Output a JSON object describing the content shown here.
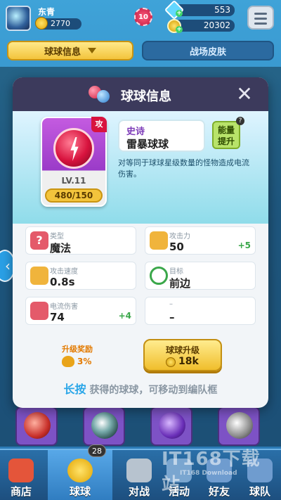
{
  "player": {
    "name": "东青",
    "trophies": "2770",
    "level": "10"
  },
  "currency": {
    "gems": "553",
    "coins": "20302"
  },
  "tabs": [
    {
      "label": "球球信息"
    },
    {
      "label": "战场皮肤"
    }
  ],
  "modal": {
    "title": "球球信息",
    "ball": {
      "type_tag": "攻",
      "level": "LV.11",
      "xp": "480/150",
      "rarity": "史诗",
      "name": "雷暴球球",
      "description": "对等同于球球星级数量的怪物造成电流伤害。"
    },
    "upgrade_chip": "能量\n提升",
    "help_mark": "?",
    "stats": [
      {
        "label": "类型",
        "value": "魔法",
        "plus": "",
        "icon": "question-icon",
        "icon_color": "#e45a6a"
      },
      {
        "label": "攻击力",
        "value": "50",
        "plus": "+5",
        "icon": "sword-icon",
        "icon_color": "#f0b43c"
      },
      {
        "label": "攻击速度",
        "value": "0.8s",
        "plus": "",
        "icon": "crossed-swords-icon",
        "icon_color": "#f0b43c"
      },
      {
        "label": "目标",
        "value": "前边",
        "plus": "",
        "icon": "target-icon",
        "icon_color": "#3aa74a"
      },
      {
        "label": "电流伤害",
        "value": "74",
        "plus": "+4",
        "icon": "lightning-icon",
        "icon_color": "#e45a6a"
      },
      {
        "label": "–",
        "value": "–",
        "plus": "",
        "icon": "",
        "icon_color": "#ffffff"
      }
    ],
    "reward": {
      "label": "升级奖励",
      "value": "3%"
    },
    "upgrade_button": {
      "label": "球球升级",
      "cost": "18k"
    },
    "hint": {
      "highlight": "长按",
      "text": "获得的球球，可移动到编队框"
    }
  },
  "nav": [
    {
      "label": "商店"
    },
    {
      "label": "球球"
    },
    {
      "label": "对战"
    },
    {
      "label": "活动"
    },
    {
      "label": "好友"
    },
    {
      "label": "球队"
    }
  ],
  "nav_badge": "28",
  "watermark": {
    "main": "IT168下载站",
    "sub": "IT168 Download"
  },
  "colors": {
    "accent_yellow": "#f3c43c",
    "header_dark": "#3c3a5c",
    "info_teal": "#8fdcea"
  }
}
